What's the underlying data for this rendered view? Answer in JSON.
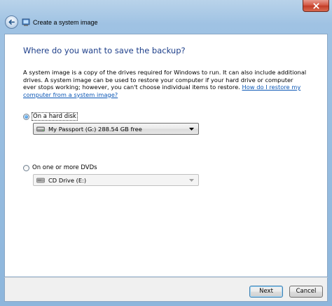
{
  "window": {
    "title": "Create a system image",
    "accent": "#1e3f8a",
    "link_color": "#0a56b5"
  },
  "icons": {
    "back": "back-arrow-icon",
    "app": "system-image-icon",
    "close": "close-icon",
    "drive": "hard-drive-icon",
    "cd": "cd-drive-icon",
    "dropdown": "chevron-down-icon"
  },
  "main": {
    "heading": "Where do you want to save the backup?",
    "description": "A system image is a copy of the drives required for Windows to run. It can also include additional drives. A system image can be used to restore your computer if your hard drive or computer ever stops working; however, you can't choose individual items to restore.",
    "help_link": "How do I restore my computer from a system image?"
  },
  "options": {
    "hard_disk": {
      "label": "On a hard disk",
      "selected": true,
      "selected_value": "My Passport (G:)  288.54 GB free"
    },
    "dvd": {
      "label": "On one or more DVDs",
      "selected": false,
      "selected_value": "CD Drive (E:)"
    }
  },
  "footer": {
    "next_label": "Next",
    "cancel_label": "Cancel"
  }
}
